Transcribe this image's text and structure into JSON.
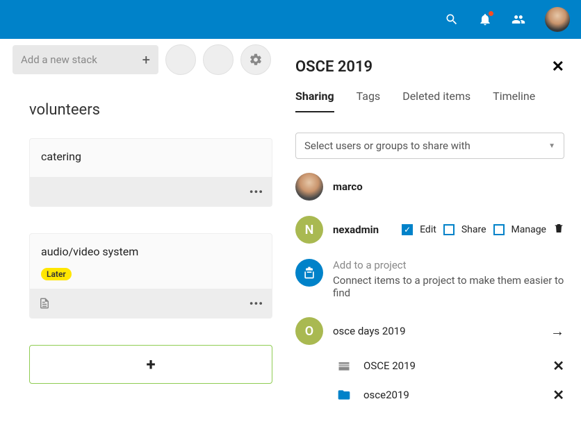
{
  "topbar": {
    "icons": {
      "search": "search-icon",
      "bell": "bell-icon",
      "people": "people-icon",
      "avatar": "avatar"
    }
  },
  "left": {
    "add_stack_placeholder": "Add a new stack",
    "stack_title": "volunteers",
    "cards": [
      {
        "title": "catering",
        "tag": null,
        "has_doc": false
      },
      {
        "title": "audio/video system",
        "tag": "Later",
        "has_doc": true
      }
    ]
  },
  "right": {
    "title": "OSCE 2019",
    "tabs": [
      "Sharing",
      "Tags",
      "Deleted items",
      "Timeline"
    ],
    "active_tab": 0,
    "share_select_placeholder": "Select users or groups to share with",
    "sharees": [
      {
        "name": "marco",
        "avatar": "photo",
        "perms": null
      },
      {
        "name": "nexadmin",
        "avatar": "N",
        "avatar_bg": "#a9b951",
        "perms": {
          "edit": true,
          "share": false,
          "manage": false
        },
        "perm_labels": {
          "edit": "Edit",
          "share": "Share",
          "manage": "Manage"
        },
        "removable": true
      }
    ],
    "project": {
      "add_title": "Add to a project",
      "add_sub": "Connect items to a project to make them easier to find",
      "name": "osce days 2019",
      "initial": "O",
      "items": [
        {
          "icon": "deck",
          "label": "OSCE 2019"
        },
        {
          "icon": "folder",
          "label": "osce2019"
        }
      ]
    }
  }
}
